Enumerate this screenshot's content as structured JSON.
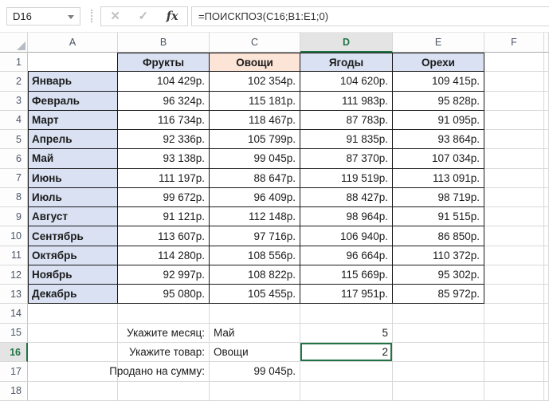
{
  "formula_bar": {
    "name_box_value": "D16",
    "formula": "=ПОИСКПОЗ(C16;B1:E1;0)",
    "cancel_icon": "✕",
    "enter_icon": "✓",
    "insert_function_icon": "fx"
  },
  "colors": {
    "accent_green": "#217346",
    "header_blue_fill": "#D9E1F2",
    "header_peach_fill": "#FCE4D6"
  },
  "grid": {
    "column_letters": [
      "A",
      "B",
      "C",
      "D",
      "E",
      "F"
    ],
    "row_numbers": [
      1,
      2,
      3,
      4,
      5,
      6,
      7,
      8,
      9,
      10,
      11,
      12,
      13,
      14,
      15,
      16,
      17,
      18
    ],
    "selected_column": "D",
    "selected_row": 16,
    "selected_cell": "D16",
    "row_count": 18
  },
  "table": {
    "category_headers": [
      "Фрукты",
      "Овощи",
      "Ягоды",
      "Орехи"
    ],
    "rows": [
      {
        "month": "Январь",
        "values": [
          "104 429р.",
          "102 354р.",
          "104 620р.",
          "109 415р."
        ]
      },
      {
        "month": "Февраль",
        "values": [
          "96 324р.",
          "115 181р.",
          "111 983р.",
          "95 828р."
        ]
      },
      {
        "month": "Март",
        "values": [
          "116 734р.",
          "118 467р.",
          "87 783р.",
          "91 095р."
        ]
      },
      {
        "month": "Апрель",
        "values": [
          "92 336р.",
          "105 799р.",
          "91 835р.",
          "93 864р."
        ]
      },
      {
        "month": "Май",
        "values": [
          "93 138р.",
          "99 045р.",
          "87 370р.",
          "107 034р."
        ]
      },
      {
        "month": "Июнь",
        "values": [
          "111 197р.",
          "88 647р.",
          "119 519р.",
          "113 091р."
        ]
      },
      {
        "month": "Июль",
        "values": [
          "99 672р.",
          "96 409р.",
          "88 427р.",
          "98 719р."
        ]
      },
      {
        "month": "Август",
        "values": [
          "91 121р.",
          "112 148р.",
          "98 964р.",
          "91 515р."
        ]
      },
      {
        "month": "Сентябрь",
        "values": [
          "113 607р.",
          "97 716р.",
          "106 940р.",
          "86 850р."
        ]
      },
      {
        "month": "Октябрь",
        "values": [
          "114 280р.",
          "108 556р.",
          "96 664р.",
          "110 372р."
        ]
      },
      {
        "month": "Ноябрь",
        "values": [
          "92 997р.",
          "108 822р.",
          "115 669р.",
          "95 302р."
        ]
      },
      {
        "month": "Декабрь",
        "values": [
          "95 080р.",
          "105 455р.",
          "117 951р.",
          "85 972р."
        ]
      }
    ]
  },
  "summary": {
    "rows": [
      {
        "row": 15,
        "label": "Укажите месяц:",
        "value": "Май",
        "result": "5"
      },
      {
        "row": 16,
        "label": "Укажите товар:",
        "value": "Овощи",
        "result": "2"
      },
      {
        "row": 17,
        "label": "Продано на сумму:",
        "value": "99 045р.",
        "result": ""
      }
    ]
  }
}
